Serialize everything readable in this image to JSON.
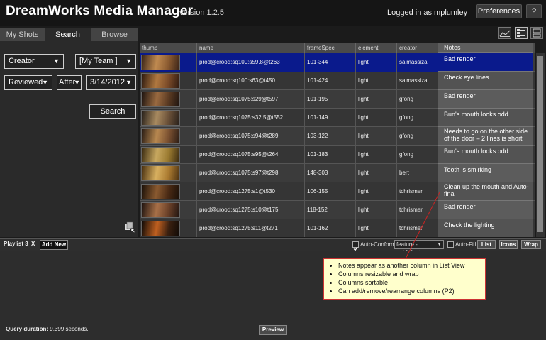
{
  "header": {
    "title": "DreamWorks Media Manager",
    "version": "version 1.2.5",
    "logged_in": "Logged in as mplumley",
    "preferences_label": "Preferences",
    "help_label": "?"
  },
  "tabs": [
    {
      "label": "My Shots"
    },
    {
      "label": "Search"
    },
    {
      "label": "Browse"
    }
  ],
  "filters": {
    "creator": "Creator",
    "team": "[My Team ]",
    "reviewed": "Reviewed",
    "after": "After",
    "date": "3/14/2012",
    "search_label": "Search"
  },
  "grid": {
    "columns": [
      "thumb",
      "name",
      "frameSpec",
      "element",
      "creator"
    ],
    "notes_header": "Notes",
    "rows": [
      {
        "name": "prod@crood:sq100:s59.8@t263",
        "frameSpec": "101-344",
        "element": "light",
        "creator": "salmassiza",
        "note": "Bad render",
        "selected": true
      },
      {
        "name": "prod@crood:sq100:s63@t450",
        "frameSpec": "101-424",
        "element": "light",
        "creator": "salmassiza",
        "note": "Check eye lines",
        "selected": false
      },
      {
        "name": "prod@crood:sq1075:s29@t597",
        "frameSpec": "101-195",
        "element": "light",
        "creator": "gfong",
        "note": "Bad render",
        "selected": false
      },
      {
        "name": "prod@crood:sq1075:s32.5@t552",
        "frameSpec": "101-149",
        "element": "light",
        "creator": "gfong",
        "note": "Bun's mouth looks odd",
        "selected": false
      },
      {
        "name": "prod@crood:sq1075:s94@t289",
        "frameSpec": "103-122",
        "element": "light",
        "creator": "gfong",
        "note": "Needs to go on the other side of the door – 2 lines is short",
        "selected": false
      },
      {
        "name": "prod@crood:sq1075:s95@t264",
        "frameSpec": "101-183",
        "element": "light",
        "creator": "gfong",
        "note": "Bun's mouth looks odd",
        "selected": false
      },
      {
        "name": "prod@crood:sq1075:s97@t298",
        "frameSpec": "148-303",
        "element": "light",
        "creator": "bert",
        "note": "Tooth is smirking",
        "selected": false
      },
      {
        "name": "prod@crood:sq1275:s1@t530",
        "frameSpec": "106-155",
        "element": "light",
        "creator": "tchrismer",
        "note": "Clean up the mouth and Auto-final",
        "selected": false
      },
      {
        "name": "prod@crood:sq1275:s10@t175",
        "frameSpec": "118-152",
        "element": "light",
        "creator": "tchrismer",
        "note": "Bad render",
        "selected": false
      },
      {
        "name": "prod@crood:sq1275:s11@t271",
        "frameSpec": "101-162",
        "element": "light",
        "creator": "tchrismer",
        "note": "Check the lighting",
        "selected": false
      }
    ]
  },
  "playlist": {
    "tab_label": "Playlist 3",
    "close_label": "X",
    "add_new_label": "Add New",
    "auto_conform_label": "Auto-Conform",
    "feature_select": "feature - published",
    "auto_fill_label": "Auto-Fill",
    "list_label": "List",
    "icons_label": "Icons",
    "wrap_label": "Wrap"
  },
  "callout": {
    "items": [
      "Notes appear as another column in List View",
      "Columns resizable and wrap",
      "Columns sortable",
      "Can add/remove/rearrange columns (P2)"
    ]
  },
  "footer": {
    "query_label": "Query duration:",
    "query_value": "9.399 seconds.",
    "preview_label": "Preview"
  },
  "colors": {
    "selected_row": "#0a1a8c",
    "callout_bg": "#ffffcc",
    "callout_border": "#cc3333"
  }
}
